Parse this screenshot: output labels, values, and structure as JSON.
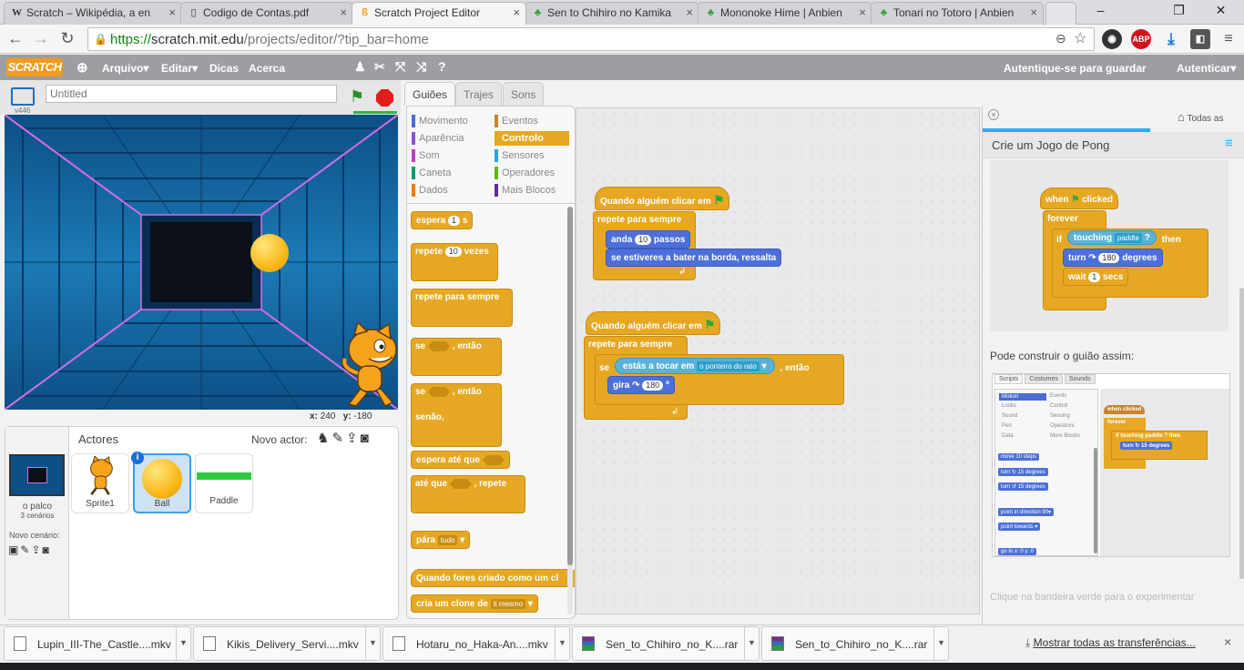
{
  "browser": {
    "tabs": [
      {
        "title": "Scratch – Wikipédia, a en",
        "icon": "W"
      },
      {
        "title": "Codigo de Contas.pdf",
        "icon": "doc"
      },
      {
        "title": "Scratch Project Editor",
        "icon": "scratch"
      },
      {
        "title": "Sen to Chihiro no Kamika",
        "icon": "clover"
      },
      {
        "title": "Mononoke Hime | Anbien",
        "icon": "clover"
      },
      {
        "title": "Tonari no Totoro | Anbien",
        "icon": "clover"
      }
    ],
    "url_secure": "https://",
    "url_host": "scratch.mit.edu",
    "url_path": "/projects/editor/?tip_bar=home"
  },
  "menubar": {
    "logo": "SCRATCH",
    "items": [
      "Arquivo▾",
      "Editar▾",
      "Dicas",
      "Acerca"
    ],
    "save_prompt": "Autentique-se para guardar",
    "signin": "Autenticar▾"
  },
  "stage": {
    "version": "v446",
    "title_placeholder": "Untitled",
    "x_label": "x:",
    "x_value": "240",
    "y_label": "y:",
    "y_value": "-180"
  },
  "sprites": {
    "header": "Actores",
    "new_sprite_label": "Novo actor:",
    "stage_label": "o palco",
    "stage_backdrops": "3 cenários",
    "new_backdrop_label": "Novo cenário:",
    "items": [
      "Sprite1",
      "Ball",
      "Paddle"
    ]
  },
  "editor_tabs": [
    "Guiões",
    "Trajes",
    "Sons"
  ],
  "categories": [
    {
      "label": "Movimento",
      "color": "#4a6cd4"
    },
    {
      "label": "Eventos",
      "color": "#c88330"
    },
    {
      "label": "Aparência",
      "color": "#8a55d7"
    },
    {
      "label": "Controlo",
      "color": "#e1a91a"
    },
    {
      "label": "Som",
      "color": "#bb42c3"
    },
    {
      "label": "Sensores",
      "color": "#2ca5e2"
    },
    {
      "label": "Caneta",
      "color": "#0e9a6c"
    },
    {
      "label": "Operadores",
      "color": "#5cb712"
    },
    {
      "label": "Dados",
      "color": "#ee7d16"
    },
    {
      "label": "Mais Blocos",
      "color": "#632d99"
    }
  ],
  "palette": {
    "wait": "espera",
    "wait_num": "1",
    "wait_unit": "s",
    "repeat": "repete",
    "repeat_num": "10",
    "repeat_unit": "vezes",
    "forever": "repete para sempre",
    "if": "se",
    "then": ", então",
    "else": "senão,",
    "wait_until": "espera até que",
    "repeat_until": "até que",
    "repeat_until_suffix": ", repete",
    "stop": "pára",
    "stop_opt": "tudo",
    "when_clone": "Quando fores criado como um cl",
    "create_clone": "cria um clone de",
    "create_clone_opt": "ti mesmo"
  },
  "scripts": {
    "s1_hat": "Quando alguém clicar em",
    "s1_forever": "repete para sempre",
    "s1_move": "anda",
    "s1_move_num": "10",
    "s1_move_unit": "passos",
    "s1_bounce": "se estiveres a bater na borda, ressalta",
    "s2_hat": "Quando alguém clicar em",
    "s2_forever": "repete para sempre",
    "s2_if": "se",
    "s2_touching": "estás a tocar em",
    "s2_touching_opt": "o ponteiro do rato",
    "s2_then": ", então",
    "s2_turn": "gira",
    "s2_turn_num": "180",
    "s2_turn_unit": "º"
  },
  "tips": {
    "home": "Todas as",
    "title": "Crie um Jogo de Pong",
    "ex_when": "when",
    "ex_clicked": "clicked",
    "ex_forever": "forever",
    "ex_if": "if",
    "ex_touching": "touching",
    "ex_touching_opt": "paddle",
    "ex_q": "?",
    "ex_then": "then",
    "ex_turn": "turn",
    "ex_turn_num": "180",
    "ex_degrees": "degrees",
    "ex_wait": "wait",
    "ex_wait_num": "1",
    "ex_secs": "secs",
    "build_text": "Pode construir o guião assim:",
    "mini_tabs": [
      "Scripts",
      "Costumes",
      "Sounds"
    ],
    "mini_cats": [
      "Motion",
      "Events",
      "Looks",
      "Control",
      "Sound",
      "Sensing",
      "Pen",
      "Operators",
      "Data",
      "More Blocks"
    ],
    "mini_blocks": [
      "move 10 steps",
      "turn ↻ 15 degrees",
      "turn ↺ 15 degrees",
      "point in direction 90▾",
      "point towards ▾",
      "go to x: 0 y: 0"
    ],
    "mini_script": [
      "when clicked",
      "forever",
      "if touching paddle ? then",
      "turn ↻ 15 degrees"
    ],
    "footer": "Clique na bandeira verde para o experimentar"
  },
  "downloads": {
    "items": [
      "Lupin_III-The_Castle....mkv",
      "Kikis_Delivery_Servi....mkv",
      "Hotaru_no_Haka-An....mkv",
      "Sen_to_Chihiro_no_K....rar",
      "Sen_to_Chihiro_no_K....rar"
    ],
    "show_all": "Mostrar todas as  transferências..."
  }
}
